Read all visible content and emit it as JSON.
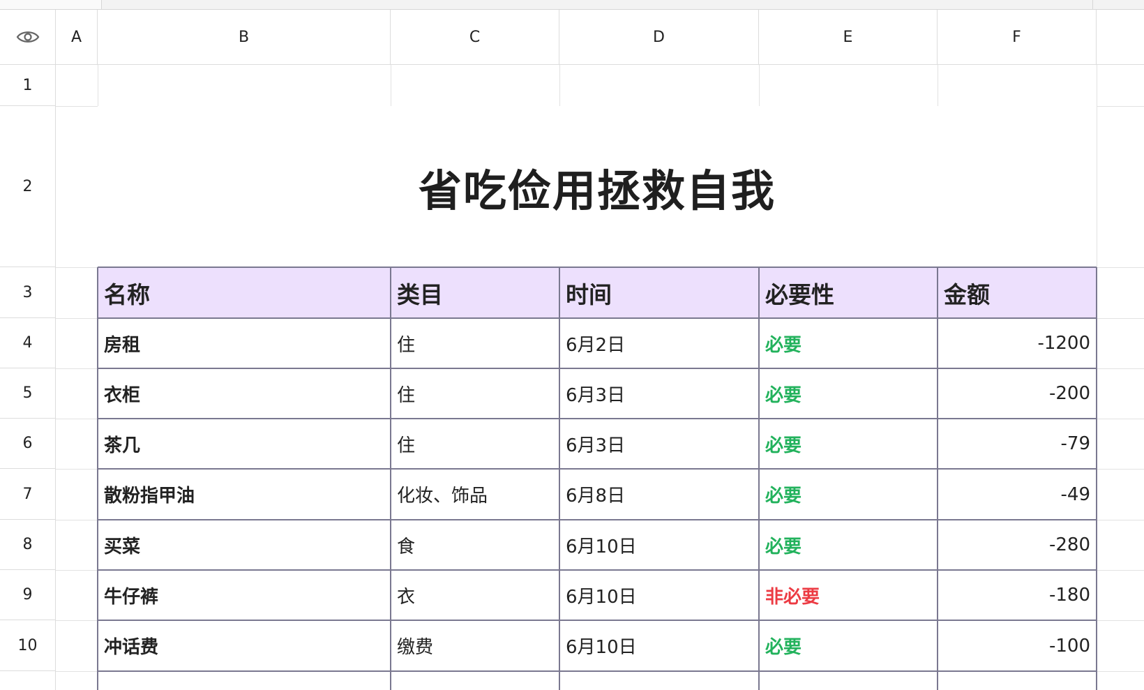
{
  "columns": [
    "A",
    "B",
    "C",
    "D",
    "E",
    "F"
  ],
  "rows": [
    "1",
    "2",
    "3",
    "4",
    "5",
    "6",
    "7",
    "8",
    "9",
    "10"
  ],
  "icons": {
    "corner": "eye-icon"
  },
  "title": "省吃俭用拯救自我",
  "table": {
    "headers": [
      "名称",
      "类目",
      "时间",
      "必要性",
      "金额"
    ],
    "records": [
      {
        "name": "房租",
        "category": "住",
        "date": "6月2日",
        "necessity": "必要",
        "amount": "-1200"
      },
      {
        "name": "衣柜",
        "category": "住",
        "date": "6月3日",
        "necessity": "必要",
        "amount": "-200"
      },
      {
        "name": "茶几",
        "category": "住",
        "date": "6月3日",
        "necessity": "必要",
        "amount": "-79"
      },
      {
        "name": "散粉指甲油",
        "category": "化妆、饰品",
        "date": "6月8日",
        "necessity": "必要",
        "amount": "-49"
      },
      {
        "name": "买菜",
        "category": "食",
        "date": "6月10日",
        "necessity": "必要",
        "amount": "-280"
      },
      {
        "name": "牛仔裤",
        "category": "衣",
        "date": "6月10日",
        "necessity": "非必要",
        "amount": "-180"
      },
      {
        "name": "冲话费",
        "category": "缴费",
        "date": "6月10日",
        "necessity": "必要",
        "amount": "-100"
      }
    ]
  },
  "colors": {
    "header_fill": "#ede0fd",
    "necessary": "#22b25c",
    "unnecessary": "#ec3b43",
    "table_border": "#7a7890"
  }
}
